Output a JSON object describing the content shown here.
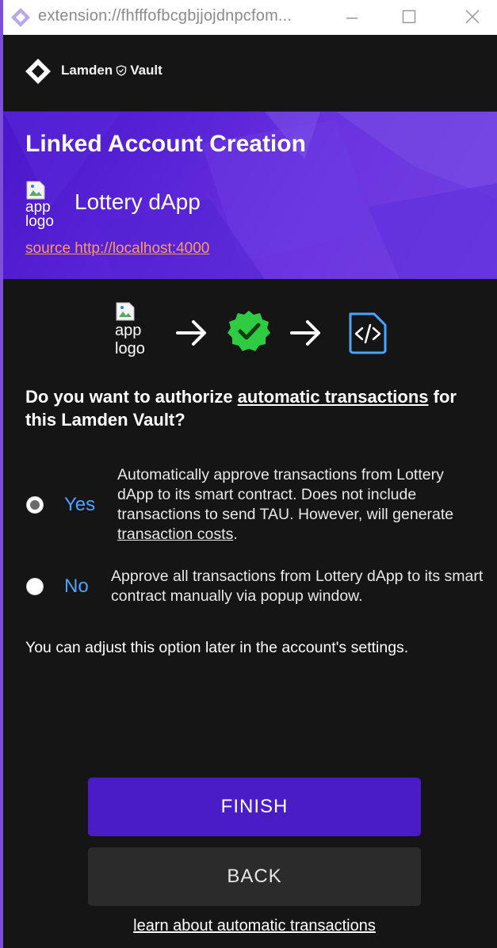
{
  "titlebar": {
    "url": "extension://fhfffofbcgbjjojdnpcfom...",
    "minimize_glyph": "–",
    "maximize_glyph": "☐",
    "close_glyph": "✕"
  },
  "header": {
    "brand_left": "Lamden",
    "brand_right": "Vault",
    "logo_icon": "diamond-logo-icon"
  },
  "banner": {
    "title": "Linked Account Creation",
    "app_logo_alt": "app logo",
    "app_name": "Lottery dApp",
    "source_label": "source http://localhost:4000"
  },
  "flow": {
    "app_logo_alt": "app logo",
    "icons": [
      "arrow-right-icon",
      "verified-check-icon",
      "arrow-right-icon",
      "code-file-icon"
    ]
  },
  "question": {
    "part1": "Do you want to authorize ",
    "link": "automatic transactions",
    "part2": " for this Lamden Vault?"
  },
  "options": {
    "yes": {
      "label": "Yes",
      "selected": true,
      "desc_text": "Automatically approve transactions from Lottery dApp to its smart contract. Does not include transactions to send TAU. However, will generate ",
      "desc_link": "transaction costs",
      "desc_end": "."
    },
    "no": {
      "label": "No",
      "selected": false,
      "desc_text": "Approve all transactions from Lottery dApp to its smart contract manually via popup window."
    }
  },
  "adjust_note": "You can adjust this option later in the account's settings.",
  "buttons": {
    "finish": "FINISH",
    "back": "BACK"
  },
  "learn_link": "learn about automatic transactions",
  "colors": {
    "accent_purple": "#4a1cc8",
    "option_blue": "#4aa3ff",
    "source_orange": "#ff9a5a",
    "check_green": "#2ecc40",
    "code_blue": "#4aa3ff"
  }
}
